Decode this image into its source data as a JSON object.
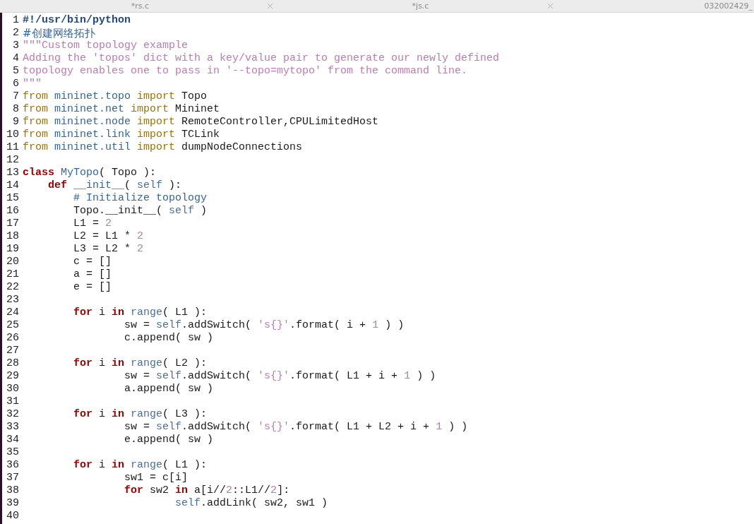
{
  "tabs": [
    {
      "label": "*rs.c",
      "closable": true
    },
    {
      "label": "*js.c",
      "closable": true
    },
    {
      "label": "032002429_",
      "closable": false
    }
  ],
  "editor": {
    "lines": [
      {
        "number": "1",
        "tokens": [
          {
            "kind": "shebang",
            "text": "#!/usr/bin/python"
          }
        ]
      },
      {
        "number": "2",
        "tokens": [
          {
            "kind": "comment_cjk",
            "text": "#创建网络拓扑"
          }
        ]
      },
      {
        "number": "3",
        "tokens": [
          {
            "kind": "docstring",
            "text": "\"\"\"Custom topology example"
          }
        ]
      },
      {
        "number": "4",
        "tokens": [
          {
            "kind": "docstring",
            "text": "Adding the 'topos' dict with a key/value pair to generate our newly defined"
          }
        ]
      },
      {
        "number": "5",
        "tokens": [
          {
            "kind": "docstring",
            "text": "topology enables one to pass in '--topo=mytopo' from the command line."
          }
        ]
      },
      {
        "number": "6",
        "tokens": [
          {
            "kind": "docstring",
            "text": "\"\"\""
          }
        ]
      },
      {
        "number": "7",
        "tokens": [
          {
            "kind": "import_kw",
            "text": "from "
          },
          {
            "kind": "name",
            "text": "mininet.topo"
          },
          {
            "kind": "import_kw",
            "text": " import"
          },
          {
            "kind": "plain",
            "text": " Topo"
          }
        ]
      },
      {
        "number": "8",
        "tokens": [
          {
            "kind": "import_kw",
            "text": "from "
          },
          {
            "kind": "name",
            "text": "mininet.net"
          },
          {
            "kind": "import_kw",
            "text": " import"
          },
          {
            "kind": "plain",
            "text": " Mininet"
          }
        ]
      },
      {
        "number": "9",
        "tokens": [
          {
            "kind": "import_kw",
            "text": "from "
          },
          {
            "kind": "name",
            "text": "mininet.node"
          },
          {
            "kind": "import_kw",
            "text": " import"
          },
          {
            "kind": "plain",
            "text": " RemoteController,CPULimitedHost"
          }
        ]
      },
      {
        "number": "10",
        "tokens": [
          {
            "kind": "import_kw",
            "text": "from "
          },
          {
            "kind": "name",
            "text": "mininet.link"
          },
          {
            "kind": "import_kw",
            "text": " import"
          },
          {
            "kind": "plain",
            "text": " TCLink"
          }
        ]
      },
      {
        "number": "11",
        "tokens": [
          {
            "kind": "import_kw",
            "text": "from "
          },
          {
            "kind": "name",
            "text": "mininet.util"
          },
          {
            "kind": "import_kw",
            "text": " import"
          },
          {
            "kind": "plain",
            "text": " dumpNodeConnections"
          }
        ]
      },
      {
        "number": "12"
      },
      {
        "number": "13",
        "tokens": [
          {
            "kind": "keyword",
            "text": "class "
          },
          {
            "kind": "name",
            "text": "MyTopo"
          },
          {
            "kind": "plain",
            "text": "( Topo ):"
          }
        ]
      },
      {
        "number": "14",
        "tokens": [
          {
            "kind": "keyword",
            "text": "    def "
          },
          {
            "kind": "name",
            "text": "__init__"
          },
          {
            "kind": "plain",
            "text": "( "
          },
          {
            "kind": "builtin",
            "text": "self"
          },
          {
            "kind": "plain",
            "text": " ):"
          }
        ]
      },
      {
        "number": "15",
        "tokens": [
          {
            "kind": "comment",
            "text": "        # Initialize topology"
          }
        ]
      },
      {
        "number": "16",
        "tokens": [
          {
            "kind": "plain",
            "text": "        Topo.__init__( "
          },
          {
            "kind": "builtin",
            "text": "self"
          },
          {
            "kind": "plain",
            "text": " )"
          }
        ]
      },
      {
        "number": "17",
        "tokens": [
          {
            "kind": "plain",
            "text": "        L1 = "
          },
          {
            "kind": "number",
            "text": "2"
          }
        ]
      },
      {
        "number": "18",
        "tokens": [
          {
            "kind": "plain",
            "text": "        L2 = L1 * "
          },
          {
            "kind": "number",
            "text": "2"
          }
        ]
      },
      {
        "number": "19",
        "tokens": [
          {
            "kind": "plain",
            "text": "        L3 = L2 * "
          },
          {
            "kind": "number",
            "text": "2"
          }
        ]
      },
      {
        "number": "20",
        "tokens": [
          {
            "kind": "plain",
            "text": "        c = []"
          }
        ]
      },
      {
        "number": "21",
        "tokens": [
          {
            "kind": "plain",
            "text": "        a = []"
          }
        ]
      },
      {
        "number": "22",
        "tokens": [
          {
            "kind": "plain",
            "text": "        e = []"
          }
        ]
      },
      {
        "number": "23"
      },
      {
        "number": "24",
        "tokens": [
          {
            "kind": "keyword",
            "text": "        for"
          },
          {
            "kind": "plain",
            "text": " i "
          },
          {
            "kind": "keyword",
            "text": "in "
          },
          {
            "kind": "builtin",
            "text": "range"
          },
          {
            "kind": "plain",
            "text": "( L1 ):"
          }
        ]
      },
      {
        "number": "25",
        "tokens": [
          {
            "kind": "plain",
            "text": "                sw = "
          },
          {
            "kind": "builtin",
            "text": "self"
          },
          {
            "kind": "plain",
            "text": ".addSwitch( "
          },
          {
            "kind": "string",
            "text": "'s{}'"
          },
          {
            "kind": "plain",
            "text": ".format( i + "
          },
          {
            "kind": "number",
            "text": "1"
          },
          {
            "kind": "plain",
            "text": " ) )"
          }
        ]
      },
      {
        "number": "26",
        "tokens": [
          {
            "kind": "plain",
            "text": "                c.append( sw )"
          }
        ]
      },
      {
        "number": "27"
      },
      {
        "number": "28",
        "tokens": [
          {
            "kind": "keyword",
            "text": "        for"
          },
          {
            "kind": "plain",
            "text": " i "
          },
          {
            "kind": "keyword",
            "text": "in "
          },
          {
            "kind": "builtin",
            "text": "range"
          },
          {
            "kind": "plain",
            "text": "( L2 ):"
          }
        ]
      },
      {
        "number": "29",
        "tokens": [
          {
            "kind": "plain",
            "text": "                sw = "
          },
          {
            "kind": "builtin",
            "text": "self"
          },
          {
            "kind": "plain",
            "text": ".addSwitch( "
          },
          {
            "kind": "string",
            "text": "'s{}'"
          },
          {
            "kind": "plain",
            "text": ".format( L1 + i + "
          },
          {
            "kind": "number",
            "text": "1"
          },
          {
            "kind": "plain",
            "text": " ) )"
          }
        ]
      },
      {
        "number": "30",
        "tokens": [
          {
            "kind": "plain",
            "text": "                a.append( sw )"
          }
        ]
      },
      {
        "number": "31"
      },
      {
        "number": "32",
        "tokens": [
          {
            "kind": "keyword",
            "text": "        for"
          },
          {
            "kind": "plain",
            "text": " i "
          },
          {
            "kind": "keyword",
            "text": "in "
          },
          {
            "kind": "builtin",
            "text": "range"
          },
          {
            "kind": "plain",
            "text": "( L3 ):"
          }
        ]
      },
      {
        "number": "33",
        "tokens": [
          {
            "kind": "plain",
            "text": "                sw = "
          },
          {
            "kind": "builtin",
            "text": "self"
          },
          {
            "kind": "plain",
            "text": ".addSwitch( "
          },
          {
            "kind": "string",
            "text": "'s{}'"
          },
          {
            "kind": "plain",
            "text": ".format( L1 + L2 + i + "
          },
          {
            "kind": "number",
            "text": "1"
          },
          {
            "kind": "plain",
            "text": " ) )"
          }
        ]
      },
      {
        "number": "34",
        "tokens": [
          {
            "kind": "plain",
            "text": "                e.append( sw )"
          }
        ]
      },
      {
        "number": "35"
      },
      {
        "number": "36",
        "tokens": [
          {
            "kind": "keyword",
            "text": "        for"
          },
          {
            "kind": "plain",
            "text": " i "
          },
          {
            "kind": "keyword",
            "text": "in "
          },
          {
            "kind": "builtin",
            "text": "range"
          },
          {
            "kind": "plain",
            "text": "( L1 ):"
          }
        ]
      },
      {
        "number": "37",
        "tokens": [
          {
            "kind": "plain",
            "text": "                sw1 = c[i]"
          }
        ]
      },
      {
        "number": "38",
        "tokens": [
          {
            "kind": "keyword",
            "text": "                for"
          },
          {
            "kind": "plain",
            "text": " sw2 "
          },
          {
            "kind": "keyword",
            "text": "in"
          },
          {
            "kind": "plain",
            "text": " a[i//"
          },
          {
            "kind": "number",
            "text": "2"
          },
          {
            "kind": "plain",
            "text": "::L1//"
          },
          {
            "kind": "number",
            "text": "2"
          },
          {
            "kind": "plain",
            "text": "]:"
          }
        ]
      },
      {
        "number": "39",
        "tokens": [
          {
            "kind": "builtin",
            "text": "                        self"
          },
          {
            "kind": "plain",
            "text": ".addLink( sw2, sw1 )"
          }
        ]
      },
      {
        "number": "40"
      }
    ]
  }
}
